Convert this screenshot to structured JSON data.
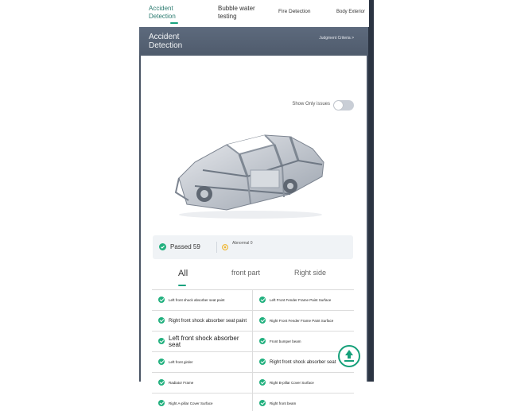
{
  "top_tabs": [
    "Accident\nDetection",
    "Bubble water\ntesting",
    "Fire Detection",
    "Body Exterior"
  ],
  "header": {
    "title": "Accident Detection",
    "judgment": "Judgment Criteria >"
  },
  "toggle": {
    "label": "Show Only issues",
    "on": false
  },
  "summary": {
    "passed": "Passed 59",
    "abnormal": "Abnormal 0"
  },
  "tabs": [
    "All",
    "front part",
    "Right side"
  ],
  "items": [
    [
      "Left front shock absorber seat paint",
      "Left Front Fender Frame Paint Surface"
    ],
    [
      "Right front shock absorber seat paint",
      "Right Front Fender Frame Paint Surface"
    ],
    [
      "Left front shock absorber seat",
      "Front bumper beam"
    ],
    [
      "Left front girder",
      "Right front shock absorber seat"
    ],
    [
      "Radiator Frame",
      "Right B-pillar Cover Surface"
    ],
    [
      "Right A-pillar Cover Surface",
      "Right front beam"
    ]
  ],
  "colors": {
    "accent": "#1aa37f",
    "header": "#56627a",
    "check": "#21b07e"
  },
  "icons": [
    "check-circle-icon",
    "warning-circle-icon",
    "upload-arrow-icon",
    "car-body-frame-image"
  ]
}
